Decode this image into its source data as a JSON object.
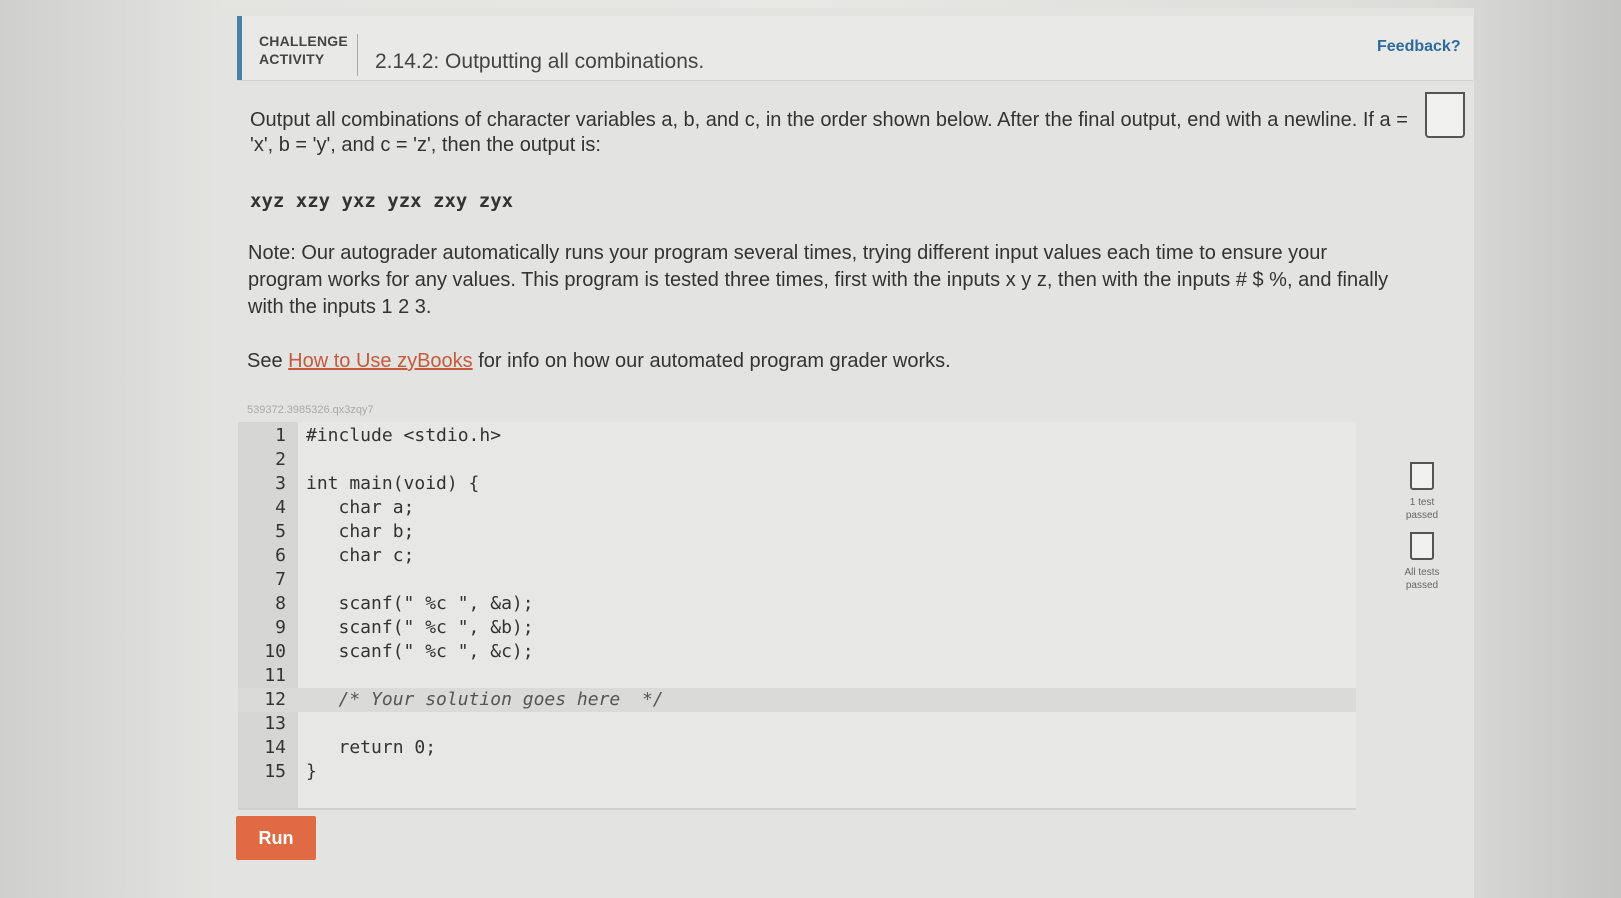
{
  "header": {
    "label_line1": "CHALLENGE",
    "label_line2": "ACTIVITY",
    "title": "2.14.2: Outputting all combinations.",
    "feedback": "Feedback?"
  },
  "description": {
    "line1": "Output all combinations of character variables a, b, and c, in the order shown below. After the final output, end with a newline. If a =",
    "line2": "'x', b = 'y', and c = 'z', then the output is:",
    "example_output": "xyz xzy yxz yzx zxy zyx",
    "note_line1": "Note: Our autograder automatically runs your program several times, trying different input values each time to ensure your",
    "note_line2": "program works for any values. This program is tested three times, first with the inputs x y z, then with the inputs # $ %, and finally",
    "note_line3": "with the inputs 1 2 3.",
    "see_prefix": "See ",
    "see_link": "How to Use zyBooks",
    "see_suffix": " for info on how our automated program grader works."
  },
  "editor": {
    "code_id": "539372.3985326.qx3zqy7",
    "lines": [
      {
        "n": "1",
        "code": "#include <stdio.h>"
      },
      {
        "n": "2",
        "code": ""
      },
      {
        "n": "3",
        "code": "int main(void) {"
      },
      {
        "n": "4",
        "code": "   char a;"
      },
      {
        "n": "5",
        "code": "   char b;"
      },
      {
        "n": "6",
        "code": "   char c;"
      },
      {
        "n": "7",
        "code": ""
      },
      {
        "n": "8",
        "code": "   scanf(\" %c \", &a);"
      },
      {
        "n": "9",
        "code": "   scanf(\" %c \", &b);"
      },
      {
        "n": "10",
        "code": "   scanf(\" %c \", &c);"
      },
      {
        "n": "11",
        "code": ""
      },
      {
        "n": "12",
        "code": "   /* Your solution goes here  */"
      },
      {
        "n": "13",
        "code": ""
      },
      {
        "n": "14",
        "code": "   return 0;"
      },
      {
        "n": "15",
        "code": "}"
      }
    ]
  },
  "tests": {
    "test1_line1": "1 test",
    "test1_line2": "passed",
    "test2_line1": "All tests",
    "test2_line2": "passed"
  },
  "run_button": "Run"
}
